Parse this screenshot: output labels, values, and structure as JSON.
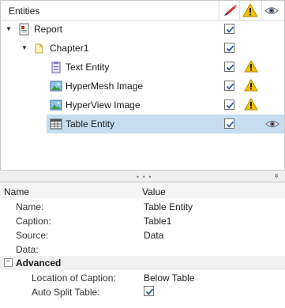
{
  "tree": {
    "header": {
      "title": "Entities"
    },
    "nodes": [
      {
        "label": "Report",
        "icon": "report-icon"
      },
      {
        "label": "Chapter1",
        "icon": "folder-icon"
      },
      {
        "label": "Text Entity",
        "icon": "text-entity-icon"
      },
      {
        "label": "HyperMesh Image",
        "icon": "image-icon"
      },
      {
        "label": "HyperView Image",
        "icon": "image-icon"
      },
      {
        "label": "Table Entity",
        "icon": "table-icon"
      }
    ]
  },
  "properties": {
    "header": {
      "name": "Name",
      "value": "Value"
    },
    "rows": [
      {
        "label": "Name:",
        "value": "Table Entity"
      },
      {
        "label": "Caption:",
        "value": "Table1"
      },
      {
        "label": "Source:",
        "value": "Data"
      },
      {
        "label": "Data:",
        "value": ""
      }
    ],
    "advanced": {
      "label": "Advanced",
      "toggle": "−",
      "rows": [
        {
          "label": "Location of Caption:",
          "value": "Below Table"
        },
        {
          "label": "Auto Split Table:",
          "value": ""
        }
      ]
    }
  },
  "splitter": {
    "grip": "• • •",
    "collapse": "»"
  },
  "colors": {
    "selected_row": "#c6dcef",
    "warning": "#f2c200",
    "checkbox_check": "#2a55a0"
  }
}
